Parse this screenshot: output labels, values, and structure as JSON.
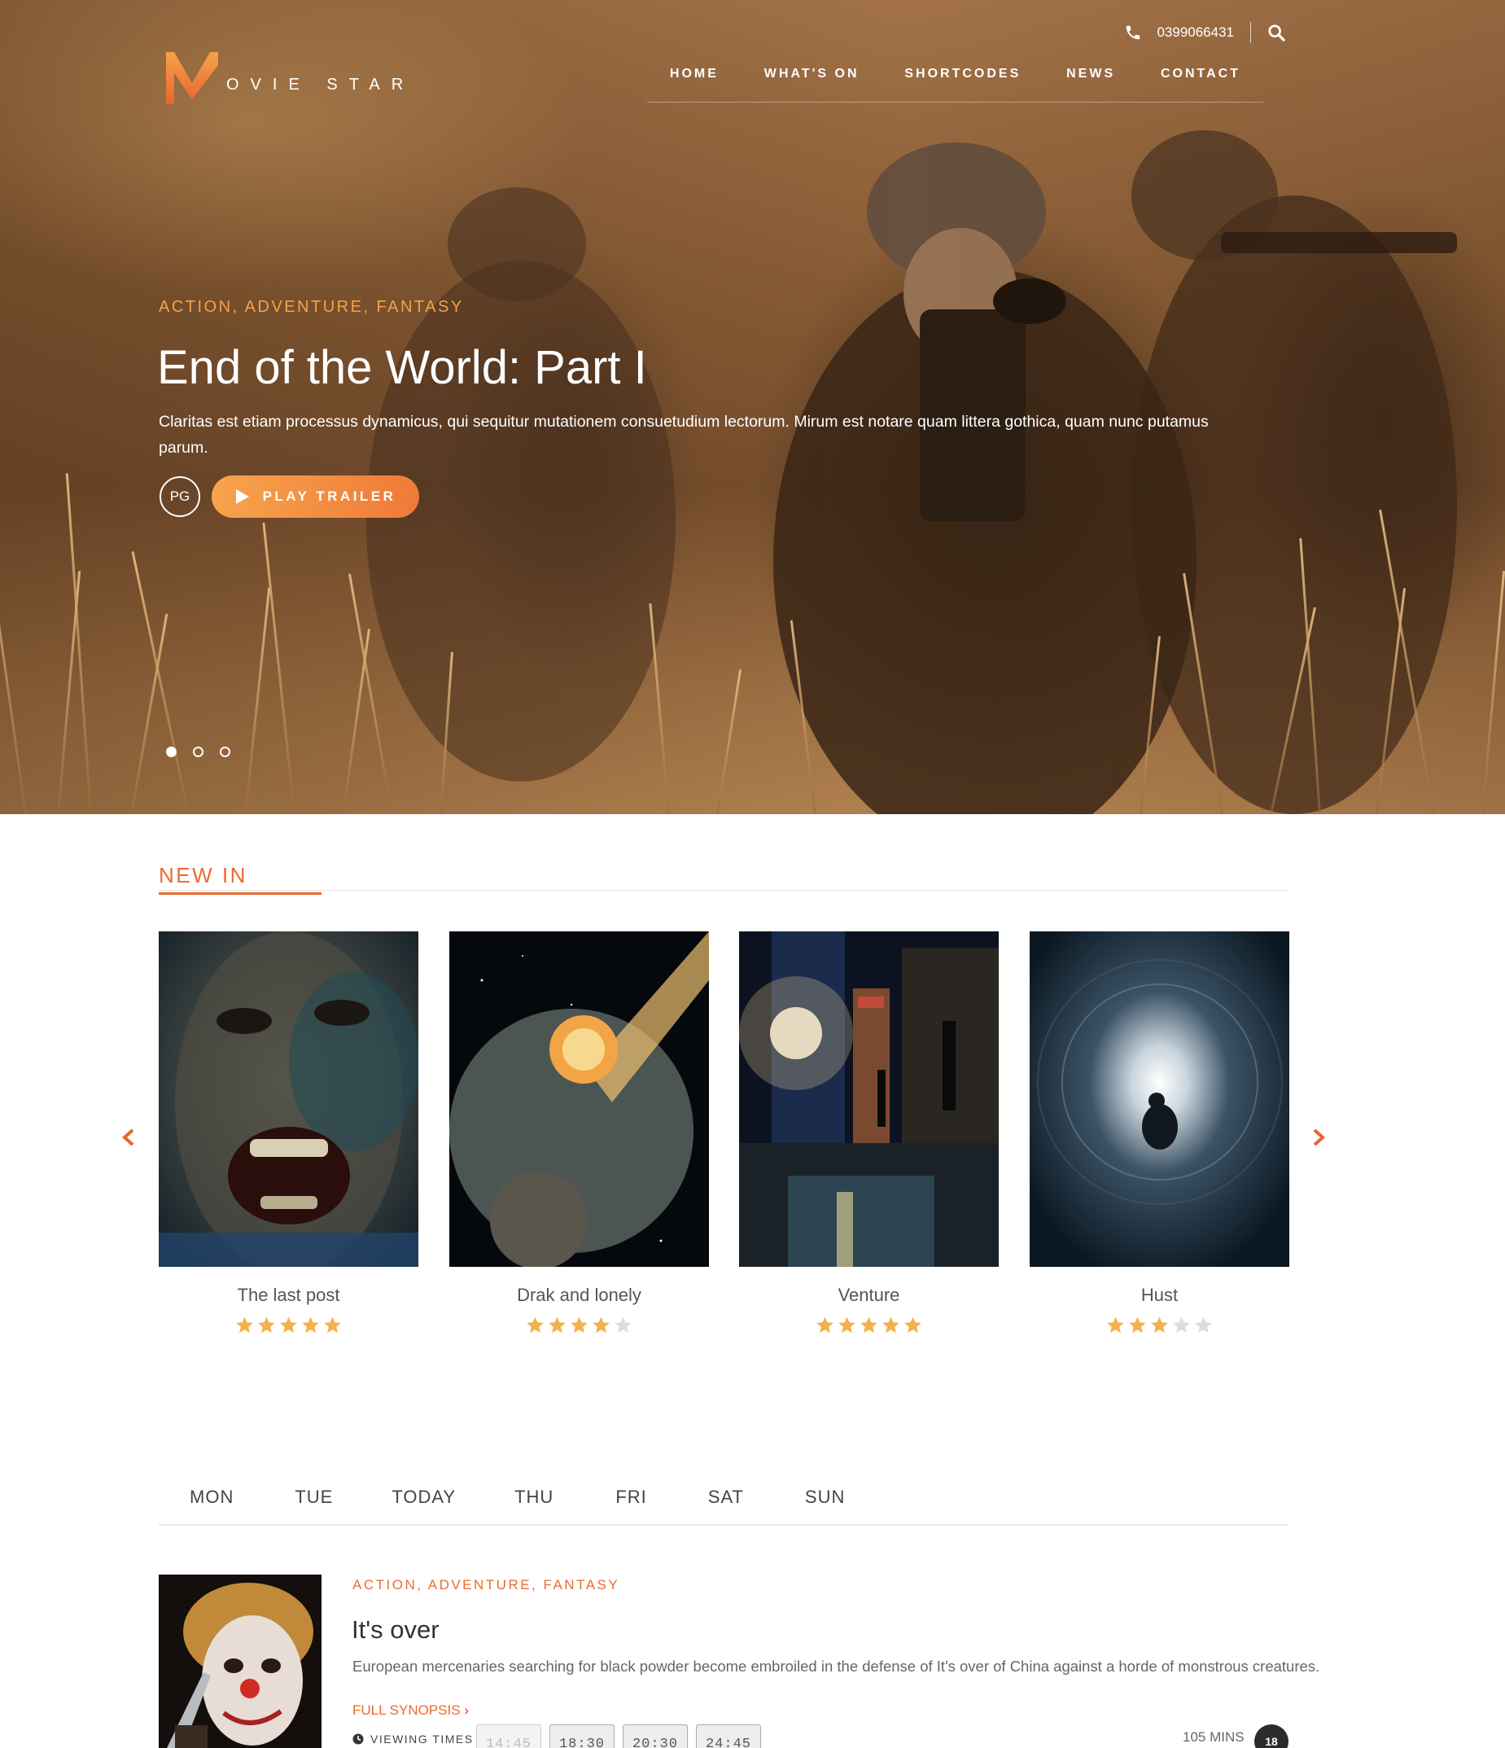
{
  "brand": {
    "logo_letter": "M",
    "logo_text": "OVIE STAR",
    "accent": "#ec6b2f"
  },
  "topbar": {
    "phone": "0399066431",
    "phone_icon": "phone-icon",
    "search_icon": "search-icon"
  },
  "nav": {
    "items": [
      "HOME",
      "WHAT'S ON",
      "SHORTCODES",
      "NEWS",
      "CONTACT"
    ]
  },
  "hero": {
    "genres": "ACTION, ADVENTURE, FANTASY",
    "title": "End of the World: Part I",
    "description": "Claritas est etiam processus dynamicus, qui sequitur mutationem consuetudium lectorum. Mirum est notare quam littera gothica, quam nunc putamus parum.",
    "rating": "PG",
    "play_label": "PLAY TRAILER",
    "slides": 3,
    "active_slide": 0
  },
  "new_in": {
    "heading": "NEW IN",
    "movies": [
      {
        "title": "The last post",
        "stars": 5
      },
      {
        "title": "Drak and lonely",
        "stars": 4
      },
      {
        "title": "Venture",
        "stars": 5
      },
      {
        "title": "Hust",
        "stars": 3
      }
    ],
    "max_stars": 5,
    "star_color": "#f5b04b",
    "star_empty_color": "#dcdcdc"
  },
  "schedule": {
    "days": [
      "MON",
      "TUE",
      "TODAY",
      "THU",
      "FRI",
      "SAT",
      "SUN"
    ],
    "movie": {
      "genres": "ACTION, ADVENTURE, FANTASY",
      "title": "It's over",
      "description": "European mercenaries searching for black powder become embroiled in the defense of It's over of China against a horde of monstrous creatures.",
      "synopsis_label": "FULL SYNOPSIS",
      "viewing_label": "VIEWING TIMES",
      "times": [
        "14:45",
        "18:30",
        "20:30",
        "24:45"
      ],
      "duration": "105 MINS",
      "age_rating": "18"
    }
  }
}
